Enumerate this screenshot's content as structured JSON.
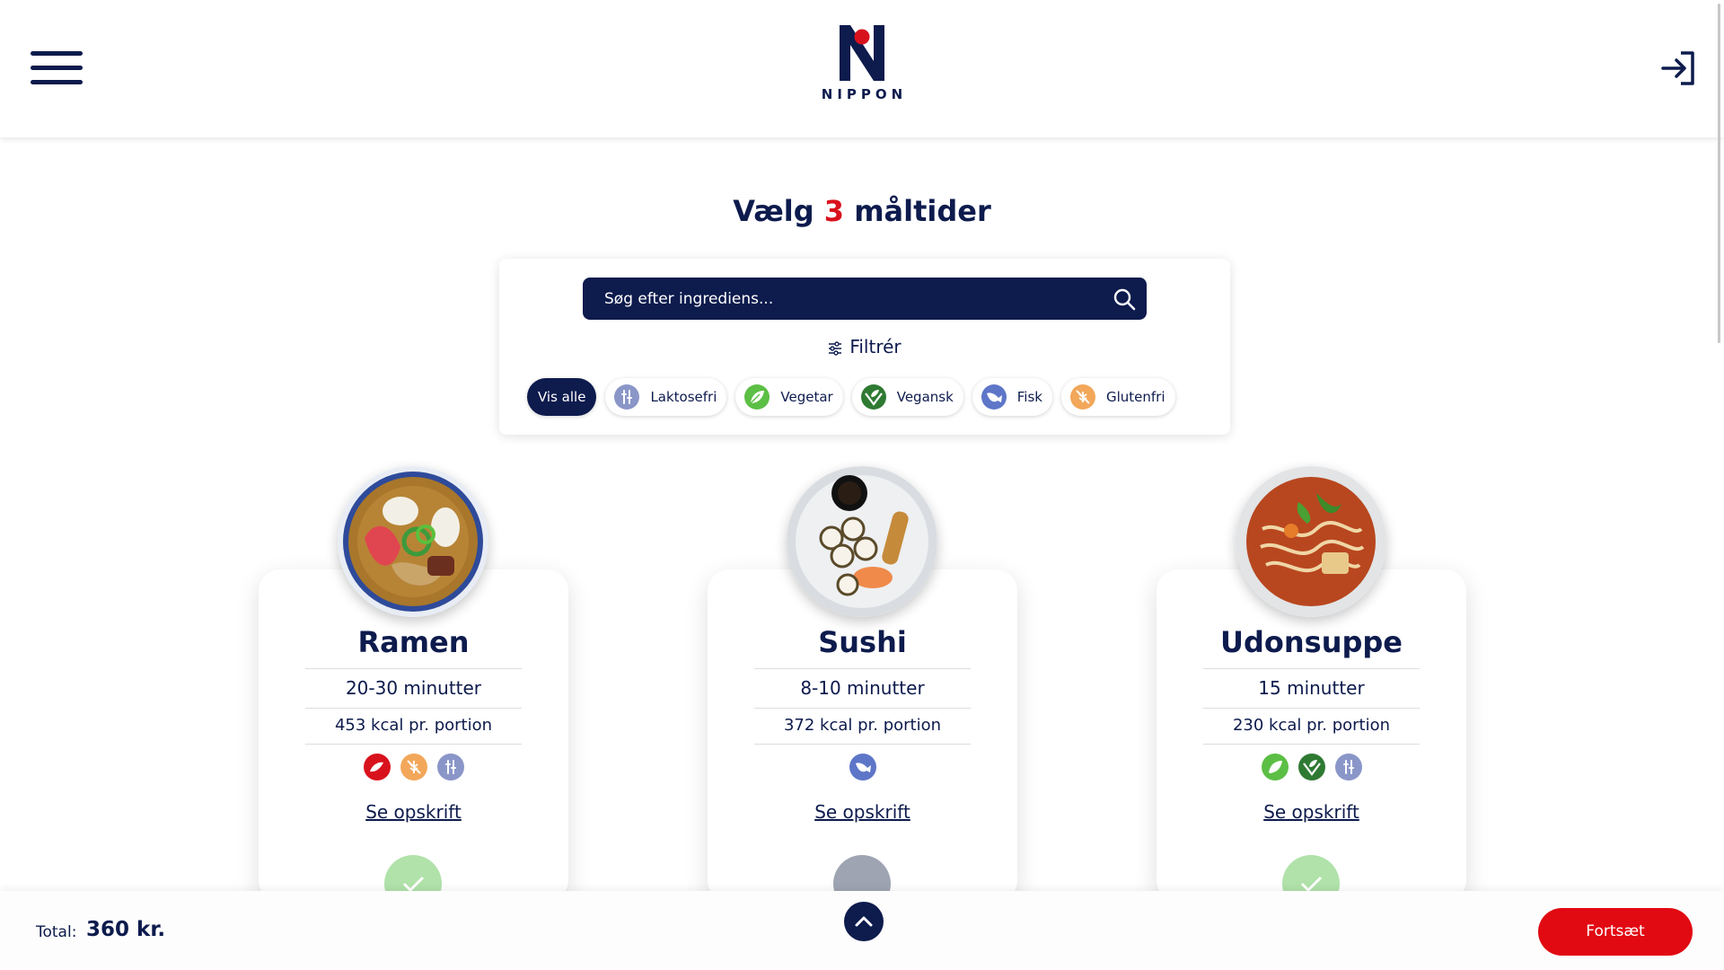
{
  "header": {
    "logo_text": "NIPPON",
    "menu_icon": "hamburger-menu-icon",
    "login_icon": "login-arrow-icon"
  },
  "title": {
    "prefix": "Vælg",
    "number": "3",
    "suffix": "måltider"
  },
  "search": {
    "placeholder": "Søg efter ingrediens...",
    "value": "",
    "icon": "search-icon"
  },
  "filter": {
    "label": "Filtrér",
    "icon": "sliders-icon",
    "chips": [
      {
        "label": "Vis alle",
        "active": true
      },
      {
        "label": "Laktosefri",
        "icon": "lactose-free-icon",
        "active": false
      },
      {
        "label": "Vegetar",
        "icon": "vegetarian-leaf-icon",
        "active": false
      },
      {
        "label": "Vegansk",
        "icon": "vegan-leaf-icon",
        "active": false
      },
      {
        "label": "Fisk",
        "icon": "fish-icon",
        "active": false
      },
      {
        "label": "Glutenfri",
        "icon": "gluten-free-icon",
        "active": false
      }
    ]
  },
  "meals": [
    {
      "name": "Ramen",
      "time": "20-30 minutter",
      "kcal": "453 kcal pr. portion",
      "icons": [
        "chili-icon",
        "gluten-free-icon",
        "lactose-free-icon"
      ],
      "link": "Se opskrift",
      "selected": true
    },
    {
      "name": "Sushi",
      "time": "8-10 minutter",
      "kcal": "372 kcal pr. portion",
      "icons": [
        "fish-icon"
      ],
      "link": "Se opskrift",
      "selected": false
    },
    {
      "name": "Udonsuppe",
      "time": "15 minutter",
      "kcal": "230 kcal pr. portion",
      "icons": [
        "vegetarian-leaf-icon",
        "vegan-leaf-icon",
        "lactose-free-icon"
      ],
      "link": "Se opskrift",
      "selected": true
    }
  ],
  "footer": {
    "total_label": "Total:",
    "total_value": "360 kr.",
    "continue_label": "Fortsæt"
  },
  "colors": {
    "navy": "#0d1b4d",
    "red": "#e10912",
    "accent_red": "#d8121d",
    "green": "#5cbf45"
  }
}
